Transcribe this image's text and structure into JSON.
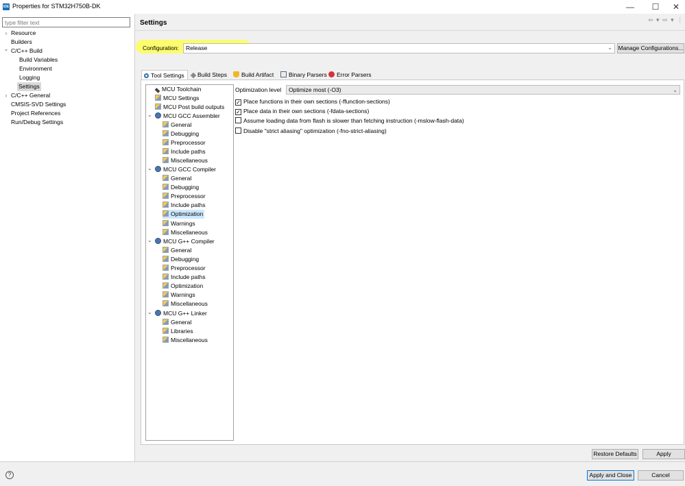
{
  "window": {
    "title": "Properties for STM32H750B-DK",
    "app_icon": "IDE",
    "minimize": "—",
    "maximize": "☐",
    "close": "✕"
  },
  "left": {
    "filter_placeholder": "type filter text",
    "items": [
      {
        "label": "Resource",
        "chev": "›"
      },
      {
        "label": "Builders"
      },
      {
        "label": "C/C++ Build",
        "chev": "⌄"
      },
      {
        "label": "Build Variables"
      },
      {
        "label": "Environment"
      },
      {
        "label": "Logging"
      },
      {
        "label": "Settings"
      },
      {
        "label": "C/C++ General",
        "chev": "›"
      },
      {
        "label": "CMSIS-SVD Settings"
      },
      {
        "label": "Project References"
      },
      {
        "label": "Run/Debug Settings"
      }
    ]
  },
  "main": {
    "title": "Settings",
    "nav_arrows": "⇦ ▾ ⇨ ▾ ⋮",
    "config_label": "Configuration:",
    "config_value": "Release",
    "manage_button": "Manage Configurations...",
    "tabs": [
      {
        "label": "Tool Settings"
      },
      {
        "label": "Build Steps"
      },
      {
        "label": "Build Artifact"
      },
      {
        "label": "Binary Parsers"
      },
      {
        "label": "Error Parsers"
      }
    ],
    "tree": [
      {
        "label": "MCU Toolchain"
      },
      {
        "label": "MCU Settings"
      },
      {
        "label": "MCU Post build outputs"
      },
      {
        "label": "MCU GCC Assembler"
      },
      {
        "label": "General"
      },
      {
        "label": "Debugging"
      },
      {
        "label": "Preprocessor"
      },
      {
        "label": "Include paths"
      },
      {
        "label": "Miscellaneous"
      },
      {
        "label": "MCU GCC Compiler"
      },
      {
        "label": "General"
      },
      {
        "label": "Debugging"
      },
      {
        "label": "Preprocessor"
      },
      {
        "label": "Include paths"
      },
      {
        "label": "Optimization"
      },
      {
        "label": "Warnings"
      },
      {
        "label": "Miscellaneous"
      },
      {
        "label": "MCU G++ Compiler"
      },
      {
        "label": "General"
      },
      {
        "label": "Debugging"
      },
      {
        "label": "Preprocessor"
      },
      {
        "label": "Include paths"
      },
      {
        "label": "Optimization"
      },
      {
        "label": "Warnings"
      },
      {
        "label": "Miscellaneous"
      },
      {
        "label": "MCU G++ Linker"
      },
      {
        "label": "General"
      },
      {
        "label": "Libraries"
      },
      {
        "label": "Miscellaneous"
      }
    ],
    "chev_down": "⌄",
    "optimization": {
      "label": "Optimization level",
      "value": "Optimize most (-O3)",
      "options": [
        {
          "label": "Place functions in their own sections (-ffunction-sections)",
          "checked": true
        },
        {
          "label": "Place data in their own sections (-fdata-sections)",
          "checked": true
        },
        {
          "label": "Assume loading data from flash is slower than fetching instruction (-mslow-flash-data)",
          "checked": false
        },
        {
          "label": "Disable \"strict aliasing\" optimization (-fno-strict-aliasing)",
          "checked": false
        }
      ],
      "check_glyph": "✓"
    },
    "restore_defaults": "Restore Defaults",
    "apply": "Apply"
  },
  "bottom": {
    "help": "?",
    "apply_close": "Apply and Close",
    "cancel": "Cancel"
  },
  "highlight_color": "#ffff4d"
}
